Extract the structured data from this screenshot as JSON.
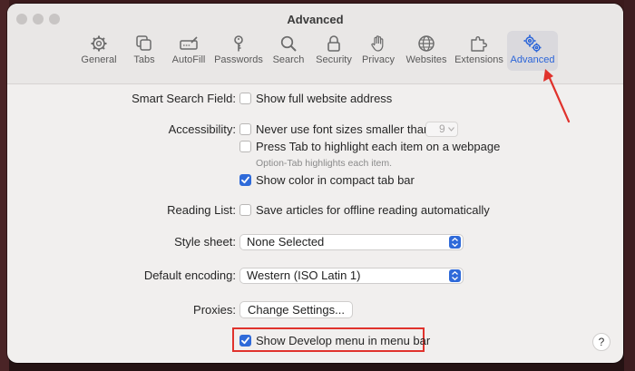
{
  "window": {
    "title": "Advanced"
  },
  "toolbar": {
    "items": [
      {
        "label": "General",
        "icon": "gear-icon"
      },
      {
        "label": "Tabs",
        "icon": "tabs-icon"
      },
      {
        "label": "AutoFill",
        "icon": "autofill-icon"
      },
      {
        "label": "Passwords",
        "icon": "key-icon"
      },
      {
        "label": "Search",
        "icon": "search-icon"
      },
      {
        "label": "Security",
        "icon": "lock-icon"
      },
      {
        "label": "Privacy",
        "icon": "hand-icon"
      },
      {
        "label": "Websites",
        "icon": "globe-icon"
      },
      {
        "label": "Extensions",
        "icon": "puzzle-icon"
      },
      {
        "label": "Advanced",
        "icon": "gears-icon",
        "active": true
      }
    ]
  },
  "settings": {
    "smart_search": {
      "label": "Smart Search Field:",
      "option": "Show full website address",
      "checked": false
    },
    "accessibility": {
      "label": "Accessibility:",
      "min_font": {
        "text": "Never use font sizes smaller than",
        "checked": false,
        "value": "9"
      },
      "press_tab": {
        "text": "Press Tab to highlight each item on a webpage",
        "checked": false
      },
      "hint": "Option-Tab highlights each item.",
      "compact": {
        "text": "Show color in compact tab bar",
        "checked": true
      }
    },
    "reading_list": {
      "label": "Reading List:",
      "option": "Save articles for offline reading automatically",
      "checked": false
    },
    "style_sheet": {
      "label": "Style sheet:",
      "value": "None Selected"
    },
    "encoding": {
      "label": "Default encoding:",
      "value": "Western (ISO Latin 1)"
    },
    "proxies": {
      "label": "Proxies:",
      "button": "Change Settings..."
    },
    "develop": {
      "text": "Show Develop menu in menu bar",
      "checked": true
    }
  },
  "help": {
    "label": "?"
  },
  "colors": {
    "accent": "#2f6ad9",
    "highlight": "#e0322c"
  }
}
